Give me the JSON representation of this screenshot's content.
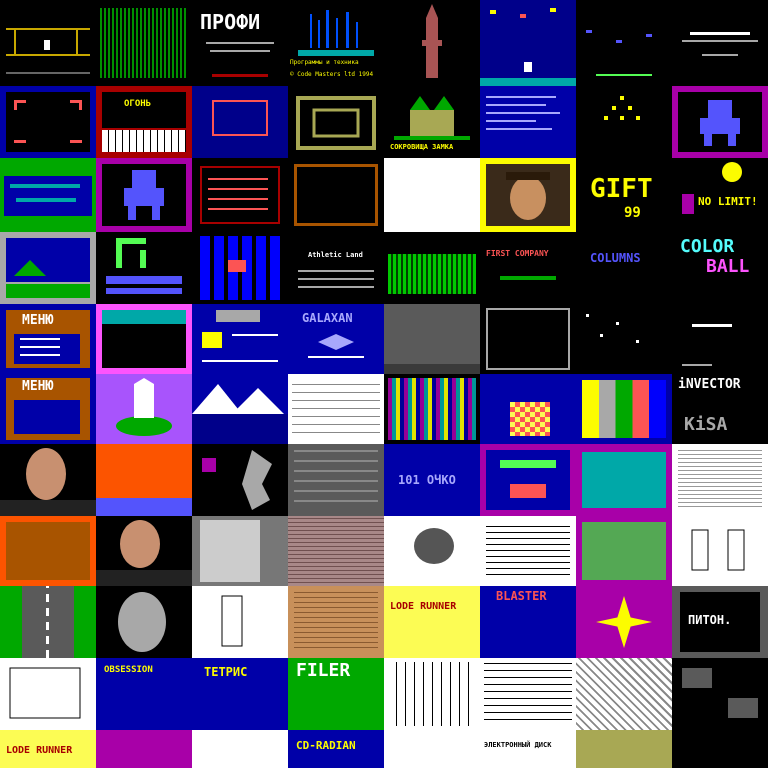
{
  "tiles": {
    "profi": "ПРОФИ",
    "copyright_line_1": "Программы и техника",
    "copyright_line_2": "© Code Masters ltd 1994",
    "treasure": "СОКРОВИЩА ЗАМКА",
    "gift": "GIFT",
    "gift_year": "99",
    "no_limit": "NO LIMIT!",
    "athletic": "Athletic Land",
    "columns": "COLUMNS",
    "color_ball_1": "COLOR",
    "color_ball_2": "BALL",
    "menu_1": "МЕНЮ",
    "menu_2": "МЕНЮ",
    "galaxan": "GALAXAN",
    "invector": "iNVECTOR",
    "kisa": "KiSA",
    "ochko": "101 ОЧКО",
    "lode_runner_1": "LODE RUNNER",
    "lode_runner_2": "LODE RUNNER",
    "blaster": "BLASTER",
    "piton": "ПИТОН.",
    "tetris": "ТЕТРИС",
    "filer": "FILER",
    "obsession": "OBSESSION",
    "first_company": "FIRST COMPANY",
    "ogon": "ОГОНЬ",
    "electronic_disk": "ЭЛЕКТРОННЫЙ ДИСК",
    "cd_radian": "CD-RADIAN"
  },
  "colors": {
    "black": "#000000",
    "blue": "#0000a8",
    "green": "#00a800",
    "cyan": "#00a8a8",
    "red": "#a80000",
    "magenta": "#a800a8",
    "yellow": "#fcfc00",
    "white": "#ffffff"
  }
}
